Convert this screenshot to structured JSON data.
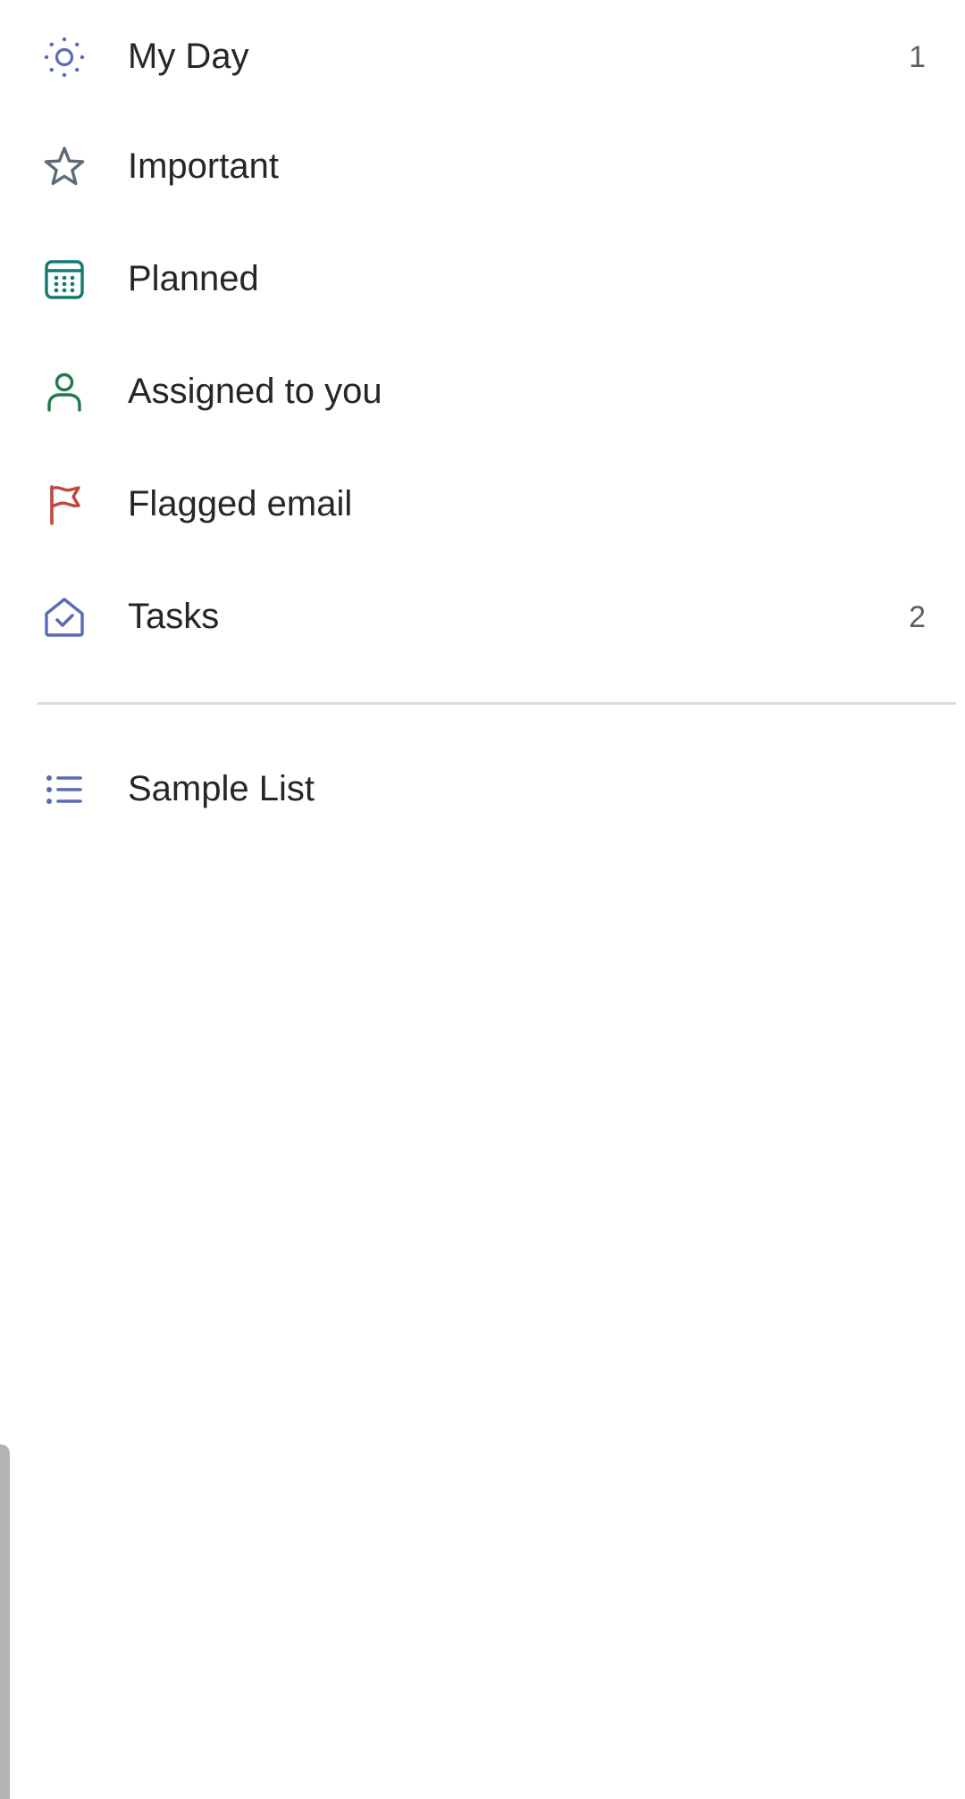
{
  "nav": {
    "items": [
      {
        "label": "My Day",
        "count": "1",
        "icon": "sun-icon",
        "color": "#5a6bb5"
      },
      {
        "label": "Important",
        "count": "",
        "icon": "star-icon",
        "color": "#5d6b78"
      },
      {
        "label": "Planned",
        "count": "",
        "icon": "calendar-icon",
        "color": "#127a6e"
      },
      {
        "label": "Assigned to you",
        "count": "",
        "icon": "person-icon",
        "color": "#1f7a4a"
      },
      {
        "label": "Flagged email",
        "count": "",
        "icon": "flag-icon",
        "color": "#c0463f"
      },
      {
        "label": "Tasks",
        "count": "2",
        "icon": "home-check-icon",
        "color": "#5a6bb5"
      }
    ]
  },
  "lists": {
    "items": [
      {
        "label": "Sample List",
        "count": "",
        "icon": "list-icon",
        "color": "#5a6bb5"
      }
    ]
  }
}
